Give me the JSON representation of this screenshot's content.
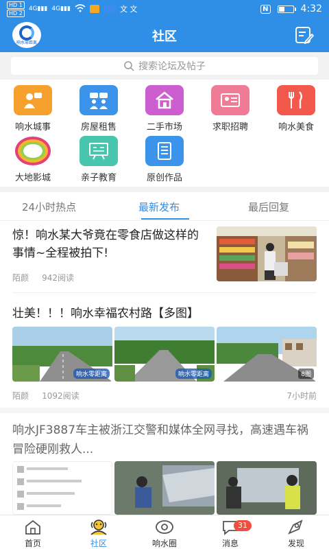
{
  "status": {
    "left_tags": [
      "HD 1",
      "HD 2"
    ],
    "signal1": "4G",
    "signal2": "4G",
    "text_glyphs": "文 文",
    "nfc": "N",
    "time": "4:32"
  },
  "header": {
    "title": "社区",
    "logo_caption": "响水零距离"
  },
  "search": {
    "placeholder": "搜索论坛及帖子"
  },
  "categories": [
    {
      "label": "响水城事",
      "color": "#f6a12e",
      "icon": "person-speech-icon"
    },
    {
      "label": "房屋租售",
      "color": "#3b93ea",
      "icon": "people-chat-icon"
    },
    {
      "label": "二手市场",
      "color": "#cd5ed0",
      "icon": "house-icon"
    },
    {
      "label": "求职招聘",
      "color": "#f07b97",
      "icon": "id-card-icon"
    },
    {
      "label": "响水美食",
      "color": "#f2584c",
      "icon": "fork-knife-icon"
    },
    {
      "label": "大地影城",
      "color": "#e2407a",
      "icon": "cinema-logo-icon"
    },
    {
      "label": "亲子教育",
      "color": "#47c6ad",
      "icon": "blackboard-icon"
    },
    {
      "label": "原创作品",
      "color": "#3b93ea",
      "icon": "document-icon"
    }
  ],
  "tabs": [
    {
      "label": "24小时热点"
    },
    {
      "label": "最新发布"
    },
    {
      "label": "最后回复"
    }
  ],
  "posts": [
    {
      "title": "惊！响水某大爷竟在零食店做这样的事情~全程被拍下!",
      "author": "陌颜",
      "reads": "942阅读"
    },
    {
      "title": "壮美！！！响水幸福农村路【多图】",
      "author": "陌颜",
      "reads": "1092阅读",
      "time": "7小时前",
      "watermark": "响水零距离",
      "photo_count": "8图"
    },
    {
      "title": "响水JF3887车主被浙江交警和媒体全网寻找，高速遇车祸冒险硬刚救人..."
    }
  ],
  "bottom_nav": [
    {
      "label": "首页",
      "icon": "home-icon"
    },
    {
      "label": "社区",
      "icon": "community-icon"
    },
    {
      "label": "响水圈",
      "icon": "circle-icon"
    },
    {
      "label": "消息",
      "icon": "message-icon",
      "badge": "31"
    },
    {
      "label": "发现",
      "icon": "discover-icon"
    }
  ],
  "colors": {
    "primary": "#2f8ee6",
    "badge": "#f04e3e"
  }
}
